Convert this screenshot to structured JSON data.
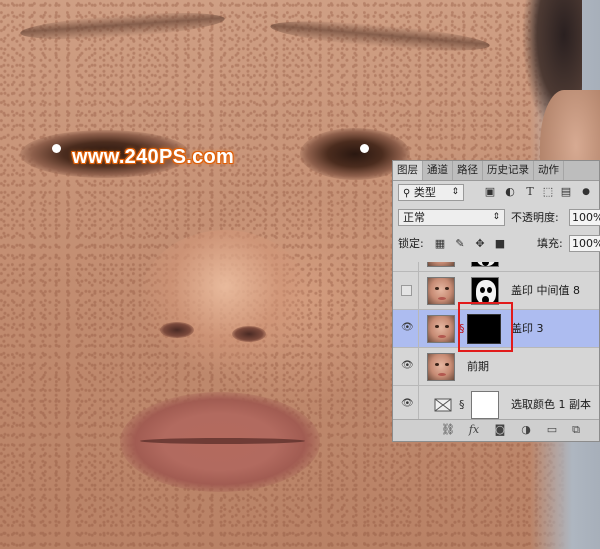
{
  "watermark": "www.240PS.com",
  "panel": {
    "tabs": [
      "图层",
      "通道",
      "路径",
      "历史记录",
      "动作"
    ],
    "active_tab": "图层",
    "filter_kind": "类型",
    "filter_icons": [
      "image-filter-icon",
      "adjustment-filter-icon",
      "type-filter-icon",
      "shape-filter-icon",
      "smart-object-filter-icon"
    ],
    "blend_mode": "正常",
    "opacity_label": "不透明度:",
    "opacity_value": "100%",
    "lock_label": "锁定:",
    "lock_icons": [
      "lock-transparent-icon",
      "lock-image-icon",
      "lock-position-icon",
      "lock-all-icon"
    ],
    "fill_label": "填充:",
    "fill_value": "100%",
    "layers": [
      {
        "name": "盖印 中间值 8",
        "visible": false,
        "selected": false
      },
      {
        "name": "盖印 3",
        "visible": true,
        "selected": true
      },
      {
        "name": "前期",
        "visible": true,
        "selected": false
      },
      {
        "name": "选取颜色 1 副本",
        "visible": true,
        "selected": false
      }
    ],
    "bottom_icons": [
      "link-icon",
      "fx-icon",
      "add-mask-icon",
      "new-adjustment-icon",
      "new-group-icon",
      "new-layer-icon"
    ],
    "fx_label": "fx"
  },
  "colors": {
    "selected_row": "#adbcf0",
    "highlight": "#e21b1b",
    "watermark_glow": "#e0600a"
  }
}
